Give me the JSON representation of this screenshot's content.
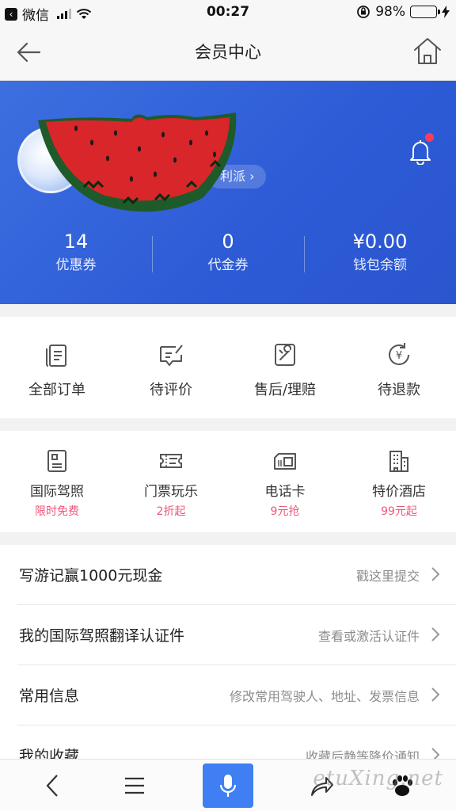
{
  "status_bar": {
    "back_app": "微信",
    "time": "00:27",
    "battery": "98%",
    "battery_level": 0.98
  },
  "nav": {
    "title": "会员中心"
  },
  "profile": {
    "privilege_label": "利派"
  },
  "stats": [
    {
      "value": "14",
      "label": "优惠券"
    },
    {
      "value": "0",
      "label": "代金券"
    },
    {
      "value": "¥0.00",
      "label": "钱包余额"
    }
  ],
  "orders": [
    {
      "label": "全部订单",
      "icon": "orders-icon"
    },
    {
      "label": "待评价",
      "icon": "review-icon"
    },
    {
      "label": "售后/理赔",
      "icon": "after-sales-icon"
    },
    {
      "label": "待退款",
      "icon": "refund-icon"
    }
  ],
  "services": [
    {
      "label": "国际驾照",
      "sub": "限时免费",
      "icon": "license-icon"
    },
    {
      "label": "门票玩乐",
      "sub": "2折起",
      "icon": "ticket-icon"
    },
    {
      "label": "电话卡",
      "sub": "9元抢",
      "icon": "sim-card-icon"
    },
    {
      "label": "特价酒店",
      "sub": "99元起",
      "icon": "hotel-icon"
    }
  ],
  "list": [
    {
      "title": "写游记赢1000元现金",
      "hint": "戳这里提交"
    },
    {
      "title": "我的国际驾照翻译认证件",
      "hint": "查看或激活认证件"
    },
    {
      "title": "常用信息",
      "hint": "修改常用驾驶人、地址、发票信息"
    },
    {
      "title": "我的收藏",
      "hint": "收藏后静等降价通知"
    }
  ],
  "colors": {
    "hero_blue": "#2d5bd6",
    "accent_pink": "#f0567a",
    "mic_blue": "#3f7ff3"
  },
  "watermark": "etuXing.net"
}
